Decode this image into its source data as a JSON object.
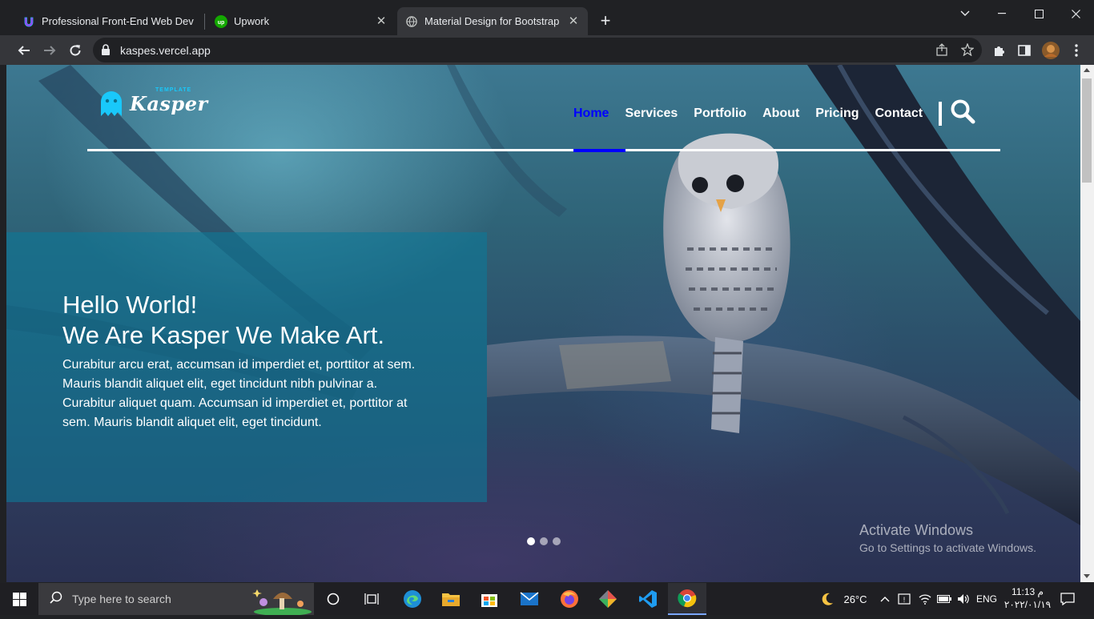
{
  "browser": {
    "tabs": [
      {
        "title": "Professional Front-End Web Dev",
        "icon": "udemy-icon"
      },
      {
        "title": "Upwork",
        "icon": "upwork-icon"
      },
      {
        "title": "Material Design for Bootstrap",
        "icon": "globe-icon",
        "active": true
      }
    ],
    "url": "kaspes.vercel.app"
  },
  "site": {
    "logo": {
      "name": "Kasper",
      "tagline": "TEMPLATE"
    },
    "nav": [
      "Home",
      "Services",
      "Portfolio",
      "About",
      "Pricing",
      "Contact"
    ],
    "active_nav": "Home",
    "hero": {
      "title_line1": "Hello World!",
      "title_line2": "We Are Kasper We Make Art.",
      "paragraph": "Curabitur arcu erat, accumsan id imperdiet et, porttitor at sem. Mauris blandit aliquet elit, eget tincidunt nibh pulvinar a. Curabitur aliquet quam. Accumsan id imperdiet et, porttitor at sem. Mauris blandit aliquet elit, eget tincidunt."
    },
    "slider": {
      "slides": 3,
      "active": 1
    },
    "colors": {
      "nav_active": "#0000ff",
      "overlay": "#0f7896",
      "logo": "#19c8fa"
    }
  },
  "watermark": {
    "line1": "Activate Windows",
    "line2": "Go to Settings to activate Windows."
  },
  "taskbar": {
    "search_placeholder": "Type here to search",
    "weather": "26°C",
    "language": "ENG",
    "time": "11:13 م",
    "date": "٢٠٢٢/٠١/١٩"
  }
}
